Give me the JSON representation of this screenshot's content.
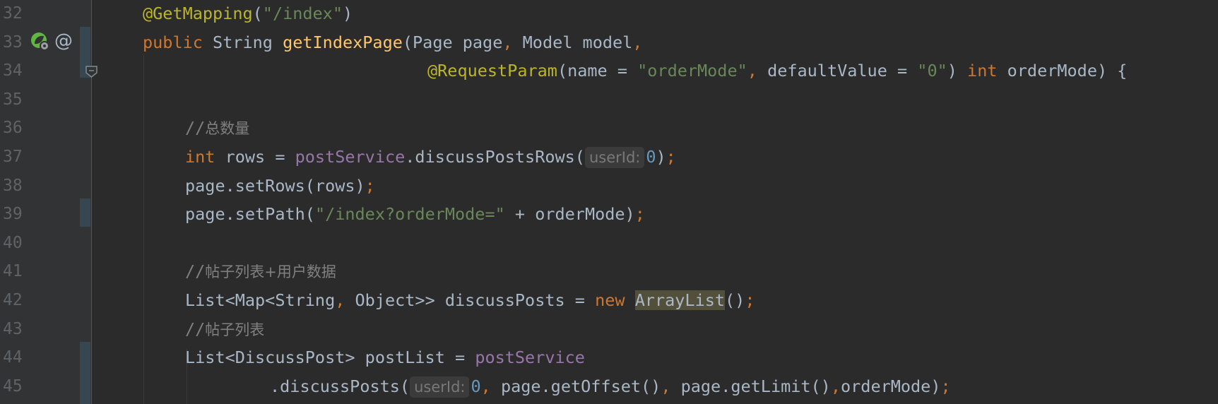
{
  "editor": {
    "gutter_icons": {
      "line33_leaf": "spring-bean-icon",
      "line33_at": "@"
    },
    "lines": [
      {
        "number": "32",
        "tokens": [
          {
            "t": "@GetMapping",
            "c": "ann"
          },
          {
            "t": "(",
            "c": "plain"
          },
          {
            "t": "\"/index\"",
            "c": "str"
          },
          {
            "t": ")",
            "c": "plain"
          }
        ]
      },
      {
        "number": "33",
        "tokens": [
          {
            "t": "public ",
            "c": "kw"
          },
          {
            "t": "String ",
            "c": "plain"
          },
          {
            "t": "getIndexPage",
            "c": "fn"
          },
          {
            "t": "(Page page",
            "c": "plain"
          },
          {
            "t": ", ",
            "c": "punct"
          },
          {
            "t": "Model model",
            "c": "plain"
          },
          {
            "t": ",",
            "c": "punct"
          }
        ]
      },
      {
        "number": "34",
        "tokens": [
          {
            "t": "@RequestParam",
            "c": "ann"
          },
          {
            "t": "(name = ",
            "c": "plain"
          },
          {
            "t": "\"orderMode\"",
            "c": "str"
          },
          {
            "t": ", ",
            "c": "punct"
          },
          {
            "t": "defaultValue = ",
            "c": "plain"
          },
          {
            "t": "\"0\"",
            "c": "str"
          },
          {
            "t": ") ",
            "c": "plain"
          },
          {
            "t": "int ",
            "c": "kw"
          },
          {
            "t": "orderMode) {",
            "c": "plain"
          }
        ]
      },
      {
        "number": "35",
        "tokens": []
      },
      {
        "number": "36",
        "tokens": [
          {
            "t": "//",
            "c": "cmt"
          },
          {
            "t": "总数量",
            "c": "cjk"
          }
        ]
      },
      {
        "number": "37",
        "tokens": [
          {
            "t": "int ",
            "c": "kw"
          },
          {
            "t": "rows = ",
            "c": "plain"
          },
          {
            "t": "postService",
            "c": "fld"
          },
          {
            "t": ".discussPostsRows(",
            "c": "plain"
          },
          {
            "t": "userId:",
            "c": "hint"
          },
          {
            "t": "0",
            "c": "num"
          },
          {
            "t": ")",
            "c": "plain"
          },
          {
            "t": ";",
            "c": "punct"
          }
        ]
      },
      {
        "number": "38",
        "tokens": [
          {
            "t": "page.setRows(rows)",
            "c": "plain"
          },
          {
            "t": ";",
            "c": "punct"
          }
        ]
      },
      {
        "number": "39",
        "tokens": [
          {
            "t": "page.setPath(",
            "c": "plain"
          },
          {
            "t": "\"/index?orderMode=\"",
            "c": "str"
          },
          {
            "t": " + orderMode)",
            "c": "plain"
          },
          {
            "t": ";",
            "c": "punct"
          }
        ]
      },
      {
        "number": "40",
        "tokens": []
      },
      {
        "number": "41",
        "tokens": [
          {
            "t": "//",
            "c": "cmt"
          },
          {
            "t": "帖子列表+用户数据",
            "c": "cjk"
          }
        ]
      },
      {
        "number": "42",
        "tokens": [
          {
            "t": "List<Map<String",
            "c": "plain"
          },
          {
            "t": ", ",
            "c": "punct"
          },
          {
            "t": "Object>> discussPosts = ",
            "c": "plain"
          },
          {
            "t": "new ",
            "c": "kw"
          },
          {
            "t": "ArrayList",
            "c": "hl"
          },
          {
            "t": "()",
            "c": "plain"
          },
          {
            "t": ";",
            "c": "punct"
          }
        ]
      },
      {
        "number": "43",
        "tokens": [
          {
            "t": "//",
            "c": "cmt"
          },
          {
            "t": "帖子列表",
            "c": "cjk"
          }
        ]
      },
      {
        "number": "44",
        "tokens": [
          {
            "t": "List<DiscussPost> postList = ",
            "c": "plain"
          },
          {
            "t": "postService",
            "c": "fld"
          }
        ]
      },
      {
        "number": "45",
        "tokens": [
          {
            "t": ".discussPosts(",
            "c": "plain"
          },
          {
            "t": "userId:",
            "c": "hint"
          },
          {
            "t": "0",
            "c": "num"
          },
          {
            "t": ", ",
            "c": "punct"
          },
          {
            "t": "page.getOffset()",
            "c": "plain"
          },
          {
            "t": ", ",
            "c": "punct"
          },
          {
            "t": "page.getLimit()",
            "c": "plain"
          },
          {
            "t": ",",
            "c": "punct"
          },
          {
            "t": "orderMode)",
            "c": "plain"
          },
          {
            "t": ";",
            "c": "punct"
          }
        ]
      }
    ]
  },
  "colors": {
    "background": "#2b2b2b",
    "gutter": "#313335",
    "keyword": "#cc7832",
    "annotation": "#bbb529",
    "string": "#6a8759",
    "method": "#ffc66d",
    "field": "#9876aa",
    "number": "#6897bb",
    "comment": "#808080",
    "text": "#a9b7c6"
  }
}
